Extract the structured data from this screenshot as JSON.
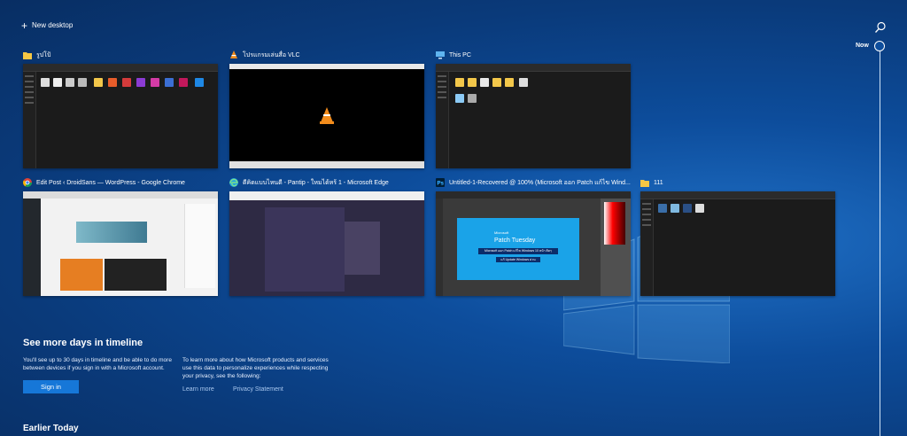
{
  "topbar": {
    "new_desktop_label": "New desktop",
    "search_icon": "search-icon"
  },
  "timeline": {
    "now_label": "Now"
  },
  "cards": {
    "row1": [
      {
        "title": "รูปโป้",
        "icon": "folder-icon"
      },
      {
        "title": "โปรแกรมเล่นสื่อ VLC",
        "icon": "vlc-icon"
      },
      {
        "title": "This PC",
        "icon": "computer-icon"
      }
    ],
    "row2": [
      {
        "title": "Edit Post ‹ DroidSans — WordPress - Google Chrome",
        "icon": "chrome-icon"
      },
      {
        "title": "ดีคิดแบบไหนดี - Pantip - ใหมได้หร้ 1 - Microsoft Edge",
        "icon": "edge-icon"
      },
      {
        "title": "Untitled-1-Recovered @ 100% (Microsoft ออก Patch แก้ไข Wind...",
        "icon": "photoshop-icon"
      },
      {
        "title": "111",
        "icon": "folder-icon"
      }
    ]
  },
  "ps_thumb": {
    "banner_line1": "Microsoft",
    "banner_line2": "Patch Tuesday",
    "bar1": "Microsoft ออก Patch แก้ไข Windows 10 หน้า ติดๆ",
    "bar2": "แก้ Update Windows ด่วน"
  },
  "promo": {
    "title": "See more days in timeline",
    "text1": "You'll see up to 30 days in timeline and be able to do more between devices if you sign in with a Microsoft account.",
    "sign_in": "Sign in",
    "text2": "To learn more about how Microsoft products and services use this data to personalize experiences while respecting your privacy, see the following:",
    "learn_more": "Learn more",
    "privacy": "Privacy Statement"
  },
  "earlier_heading": "Earlier Today",
  "colors": {
    "accent": "#1677d8",
    "link": "#a9c8ef",
    "background": "#0d4d9c"
  }
}
